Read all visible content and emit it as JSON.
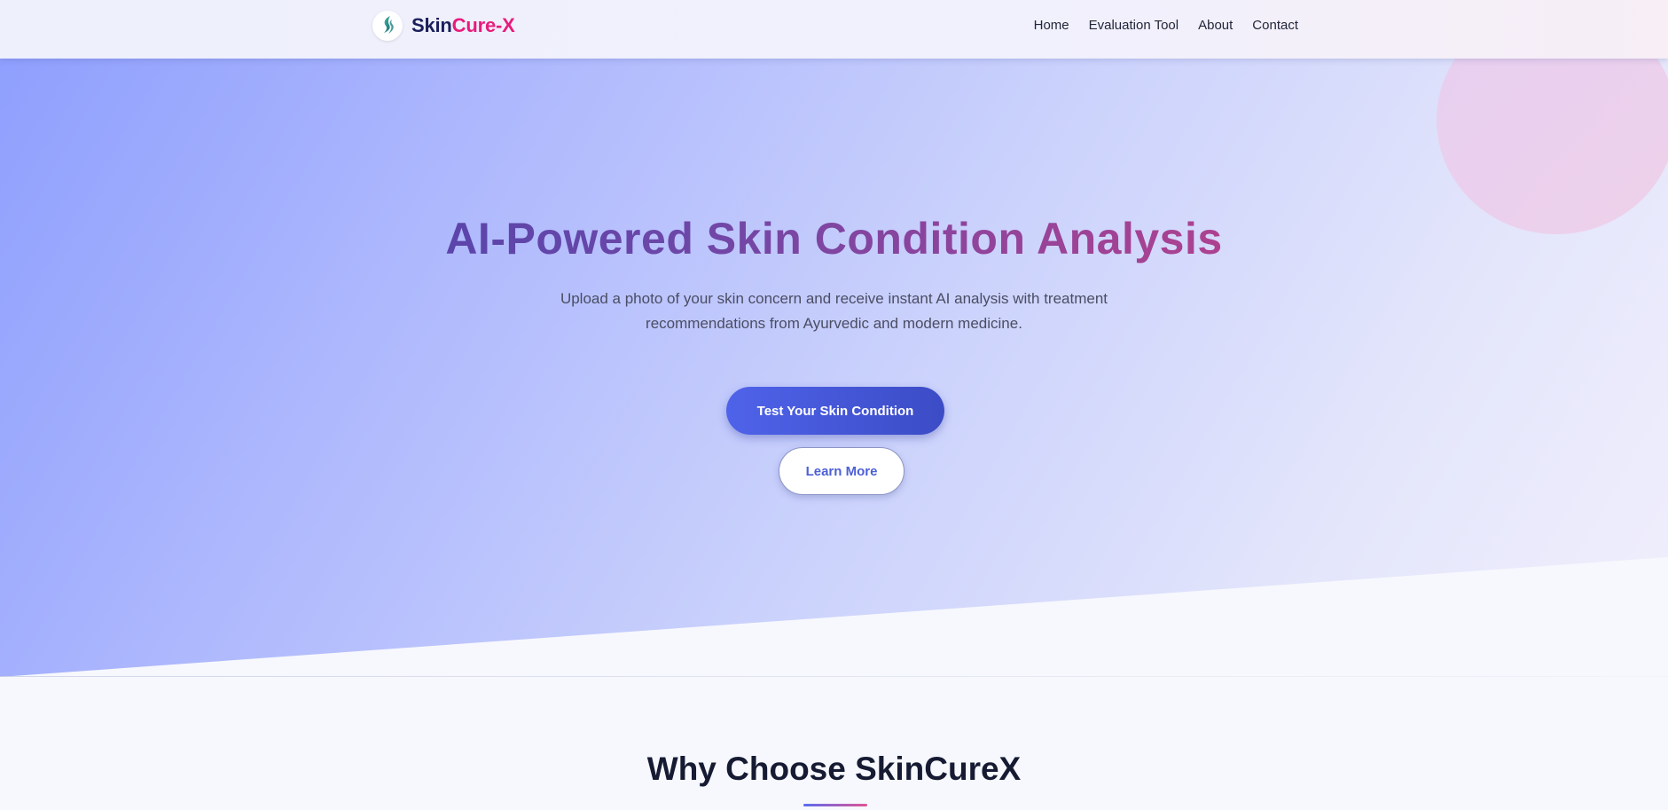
{
  "navbar": {
    "brand_part1": "Skin",
    "brand_part2": "Cure-X",
    "links": [
      {
        "label": "Home"
      },
      {
        "label": "Evaluation Tool"
      },
      {
        "label": "About"
      },
      {
        "label": "Contact"
      }
    ]
  },
  "hero": {
    "title": "AI-Powered Skin Condition Analysis",
    "subtitle": "Upload a photo of your skin concern and receive instant AI analysis with treatment recommendations from Ayurvedic and modern medicine.",
    "primary_button": "Test Your Skin Condition",
    "secondary_button": "Learn More"
  },
  "features": {
    "title": "Why Choose SkinCureX"
  },
  "colors": {
    "brand_dark": "#1b1f5a",
    "brand_accent": "#e81b7c",
    "primary": "#4f63ea",
    "secondary_text": "#4d5fd6"
  },
  "icons": {
    "logo": "leaf-logo-icon"
  }
}
